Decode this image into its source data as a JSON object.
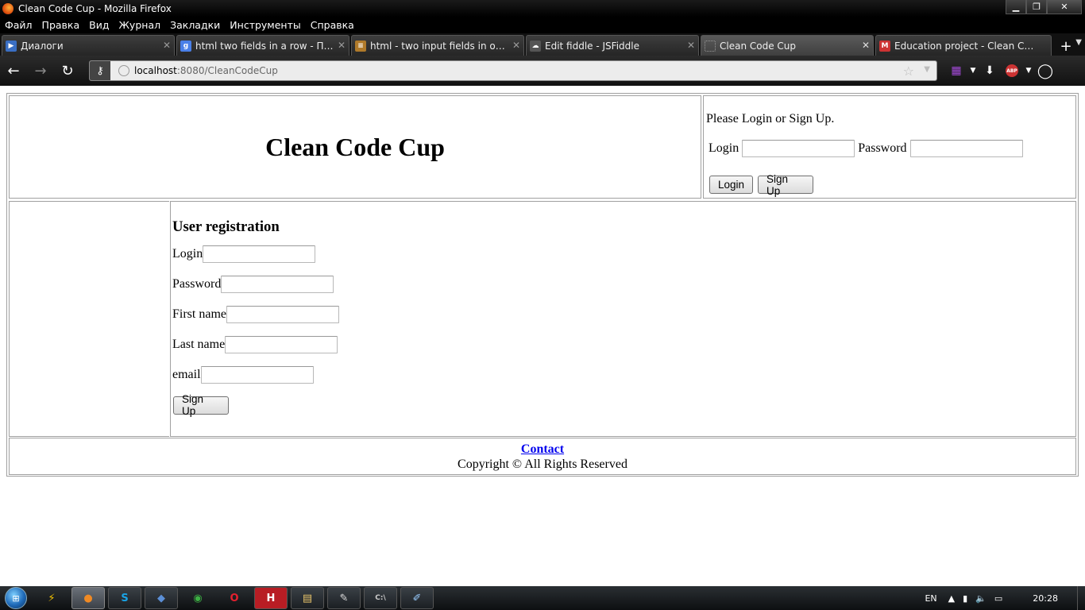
{
  "window": {
    "title": "Clean Code Cup - Mozilla Firefox",
    "minimize": "▁",
    "maximize": "❐",
    "close": "✕"
  },
  "menu": [
    "Файл",
    "Правка",
    "Вид",
    "Журнал",
    "Закладки",
    "Инструменты",
    "Справка"
  ],
  "tabs": [
    {
      "label": "Диалоги",
      "icon": "dialogs-icon",
      "color": "#3a6fc4",
      "glyph": "▶"
    },
    {
      "label": "html two fields in a row - Поис...",
      "icon": "google-icon",
      "color": "#4a80e8",
      "glyph": "g"
    },
    {
      "label": "html - two input fields in one r...",
      "icon": "stackoverflow-icon",
      "color": "#b07a2a",
      "glyph": "≡"
    },
    {
      "label": "Edit fiddle - JSFiddle",
      "icon": "jsfiddle-icon",
      "color": "#555555",
      "glyph": "☁"
    },
    {
      "label": "Clean Code Cup",
      "icon": "page-icon",
      "color": "#666666",
      "glyph": ""
    },
    {
      "label": "Education project - Clean Code...",
      "icon": "gmail-icon",
      "color": "#cc3333",
      "glyph": "M"
    }
  ],
  "tab_close": "✕",
  "nav": {
    "back": "←",
    "forward": "→",
    "reload": "↻",
    "url_host": "localhost",
    "url_path": ":8080/CleanCodeCup"
  },
  "page": {
    "heading": "Clean Code Cup",
    "login_prompt": "Please Login or Sign Up.",
    "login_label": "Login",
    "password_label": "Password",
    "login_button": "Login",
    "signup_button": "Sign Up",
    "registration": {
      "title": "User registration",
      "fields": [
        "Login",
        "Password",
        "First name",
        "Last name",
        "email"
      ],
      "submit": "Sign Up"
    },
    "footer": {
      "contact": "Contact",
      "copyright": "Copyright © All Rights Reserved"
    }
  },
  "taskbar": {
    "apps": [
      {
        "name": "quick-launch-icon",
        "glyph": "⚡"
      },
      {
        "name": "firefox-taskbar-icon",
        "glyph": "●"
      },
      {
        "name": "skype-taskbar-icon",
        "glyph": "S"
      },
      {
        "name": "virtualbox-taskbar-icon",
        "glyph": "◆"
      },
      {
        "name": "chrome-taskbar-icon",
        "glyph": "◉"
      },
      {
        "name": "opera-taskbar-icon",
        "glyph": "O"
      },
      {
        "name": "h-app-taskbar-icon",
        "glyph": "H"
      },
      {
        "name": "explorer-taskbar-icon",
        "glyph": "▤"
      },
      {
        "name": "notepad-taskbar-icon",
        "glyph": "✎"
      },
      {
        "name": "cmd-taskbar-icon",
        "glyph": "C:\\"
      },
      {
        "name": "editor-taskbar-icon",
        "glyph": "✐"
      }
    ],
    "language": "EN",
    "clock": "20:28"
  }
}
